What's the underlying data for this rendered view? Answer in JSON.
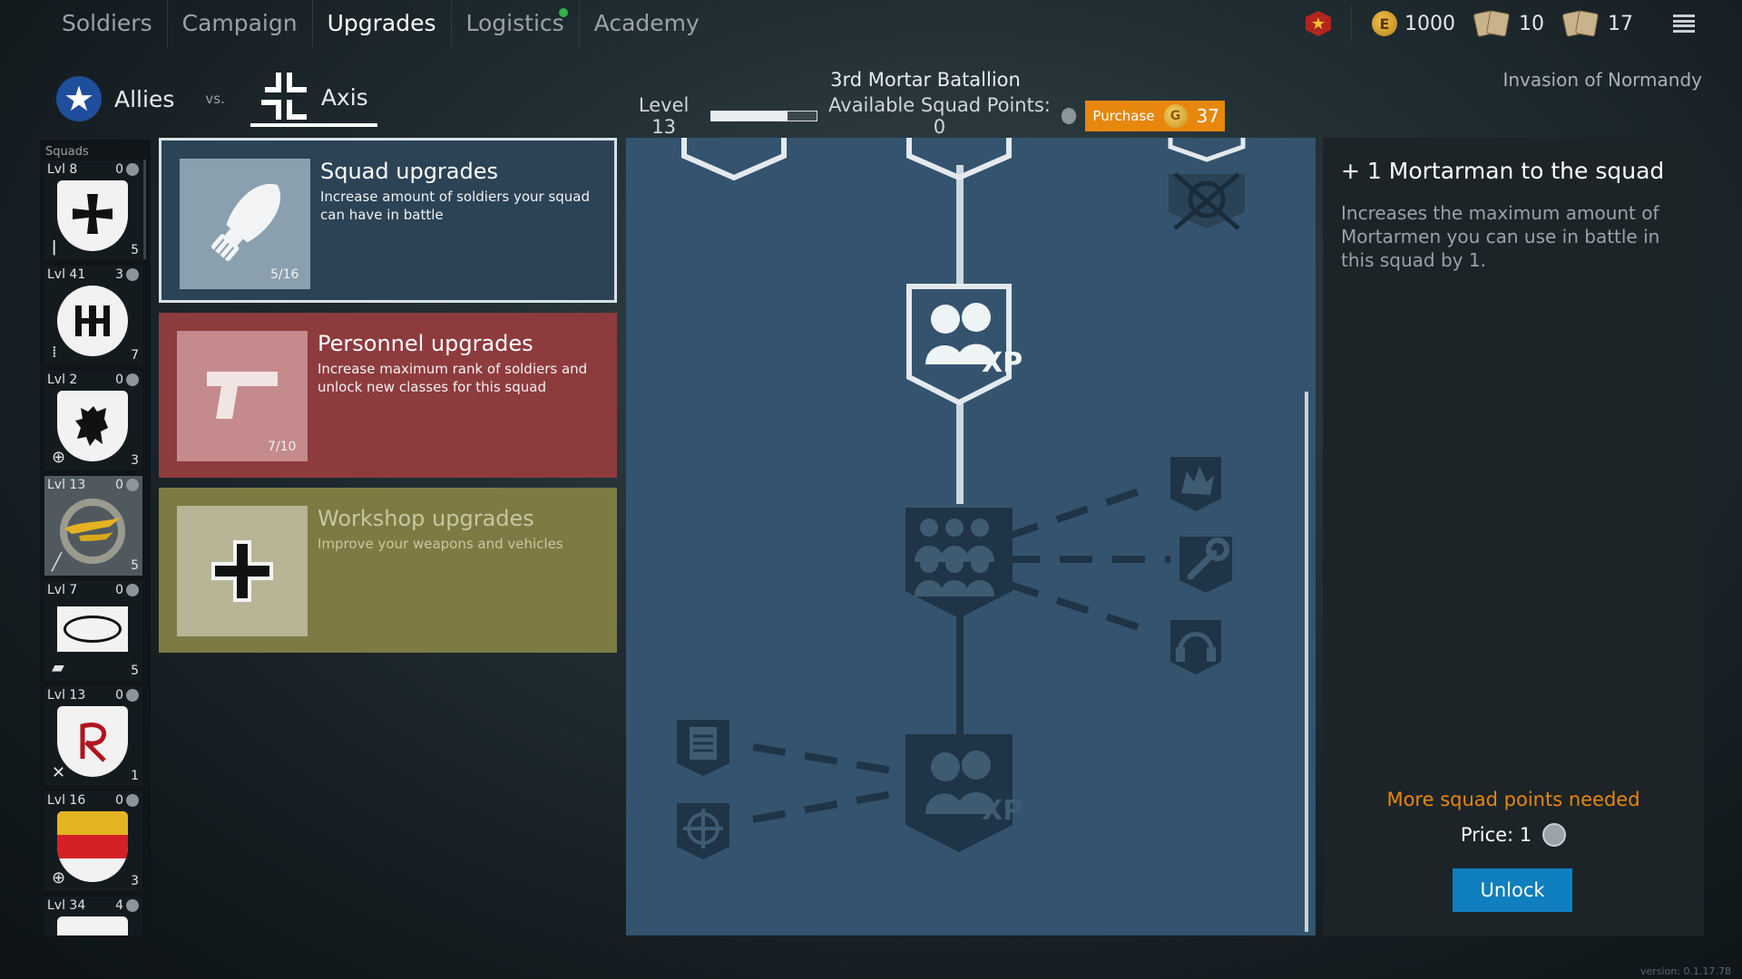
{
  "nav": {
    "tabs": [
      {
        "label": "Soldiers"
      },
      {
        "label": "Campaign"
      },
      {
        "label": "Upgrades"
      },
      {
        "label": "Logistics"
      },
      {
        "label": "Academy"
      }
    ]
  },
  "resources": {
    "gold": "1000",
    "gold_icon_letter": "E",
    "cards_a": "10",
    "cards_b": "17"
  },
  "factions": {
    "allies": "Allies",
    "vs": "vs.",
    "axis": "Axis"
  },
  "squad": {
    "name": "3rd Mortar Batallion",
    "level": "Level 13",
    "level_progress": 0.72,
    "points_label": "Available Squad Points: 0",
    "purchase_label": "Purchase",
    "purchase_coin": "G",
    "purchase_value": "37"
  },
  "campaign_name": "Invasion of Normandy",
  "squads_panel": {
    "title": "Squads",
    "items": [
      {
        "lvl": "Lvl 8",
        "pts": "0",
        "count": "5"
      },
      {
        "lvl": "Lvl 41",
        "pts": "3",
        "count": "7"
      },
      {
        "lvl": "Lvl 2",
        "pts": "0",
        "count": "3"
      },
      {
        "lvl": "Lvl 13",
        "pts": "0",
        "count": "5"
      },
      {
        "lvl": "Lvl 7",
        "pts": "0",
        "count": "5"
      },
      {
        "lvl": "Lvl 13",
        "pts": "0",
        "count": "1"
      },
      {
        "lvl": "Lvl 16",
        "pts": "0",
        "count": "3"
      },
      {
        "lvl": "Lvl 34",
        "pts": "4",
        "count": ""
      }
    ]
  },
  "categories": {
    "squad": {
      "title": "Squad upgrades",
      "desc": "Increase amount of soldiers your squad can have in battle",
      "progress": "5/16"
    },
    "personnel": {
      "title": "Personnel upgrades",
      "desc": "Increase maximum rank of soldiers and unlock new classes for this squad",
      "progress": "7/10"
    },
    "workshop": {
      "title": "Workshop upgrades",
      "desc": "Improve your weapons and vehicles"
    }
  },
  "tree": {
    "xp_label": "XP"
  },
  "detail": {
    "title": "+ 1 Mortarman to the squad",
    "description": "Increases the maximum amount of Mortarmen you can use in battle in this squad by 1.",
    "warning": "More squad points needed",
    "price_label": "Price: 1",
    "unlock_label": "Unlock"
  },
  "version": "version: 0.1.17.78",
  "colors": {
    "accent_orange": "#e8870e",
    "unlock_blue": "#0f7fbf",
    "squad_blue": "#2c4356",
    "personnel_red": "#8e3b3e",
    "workshop_olive": "#7e7a43",
    "tree_bg": "#34536e"
  }
}
